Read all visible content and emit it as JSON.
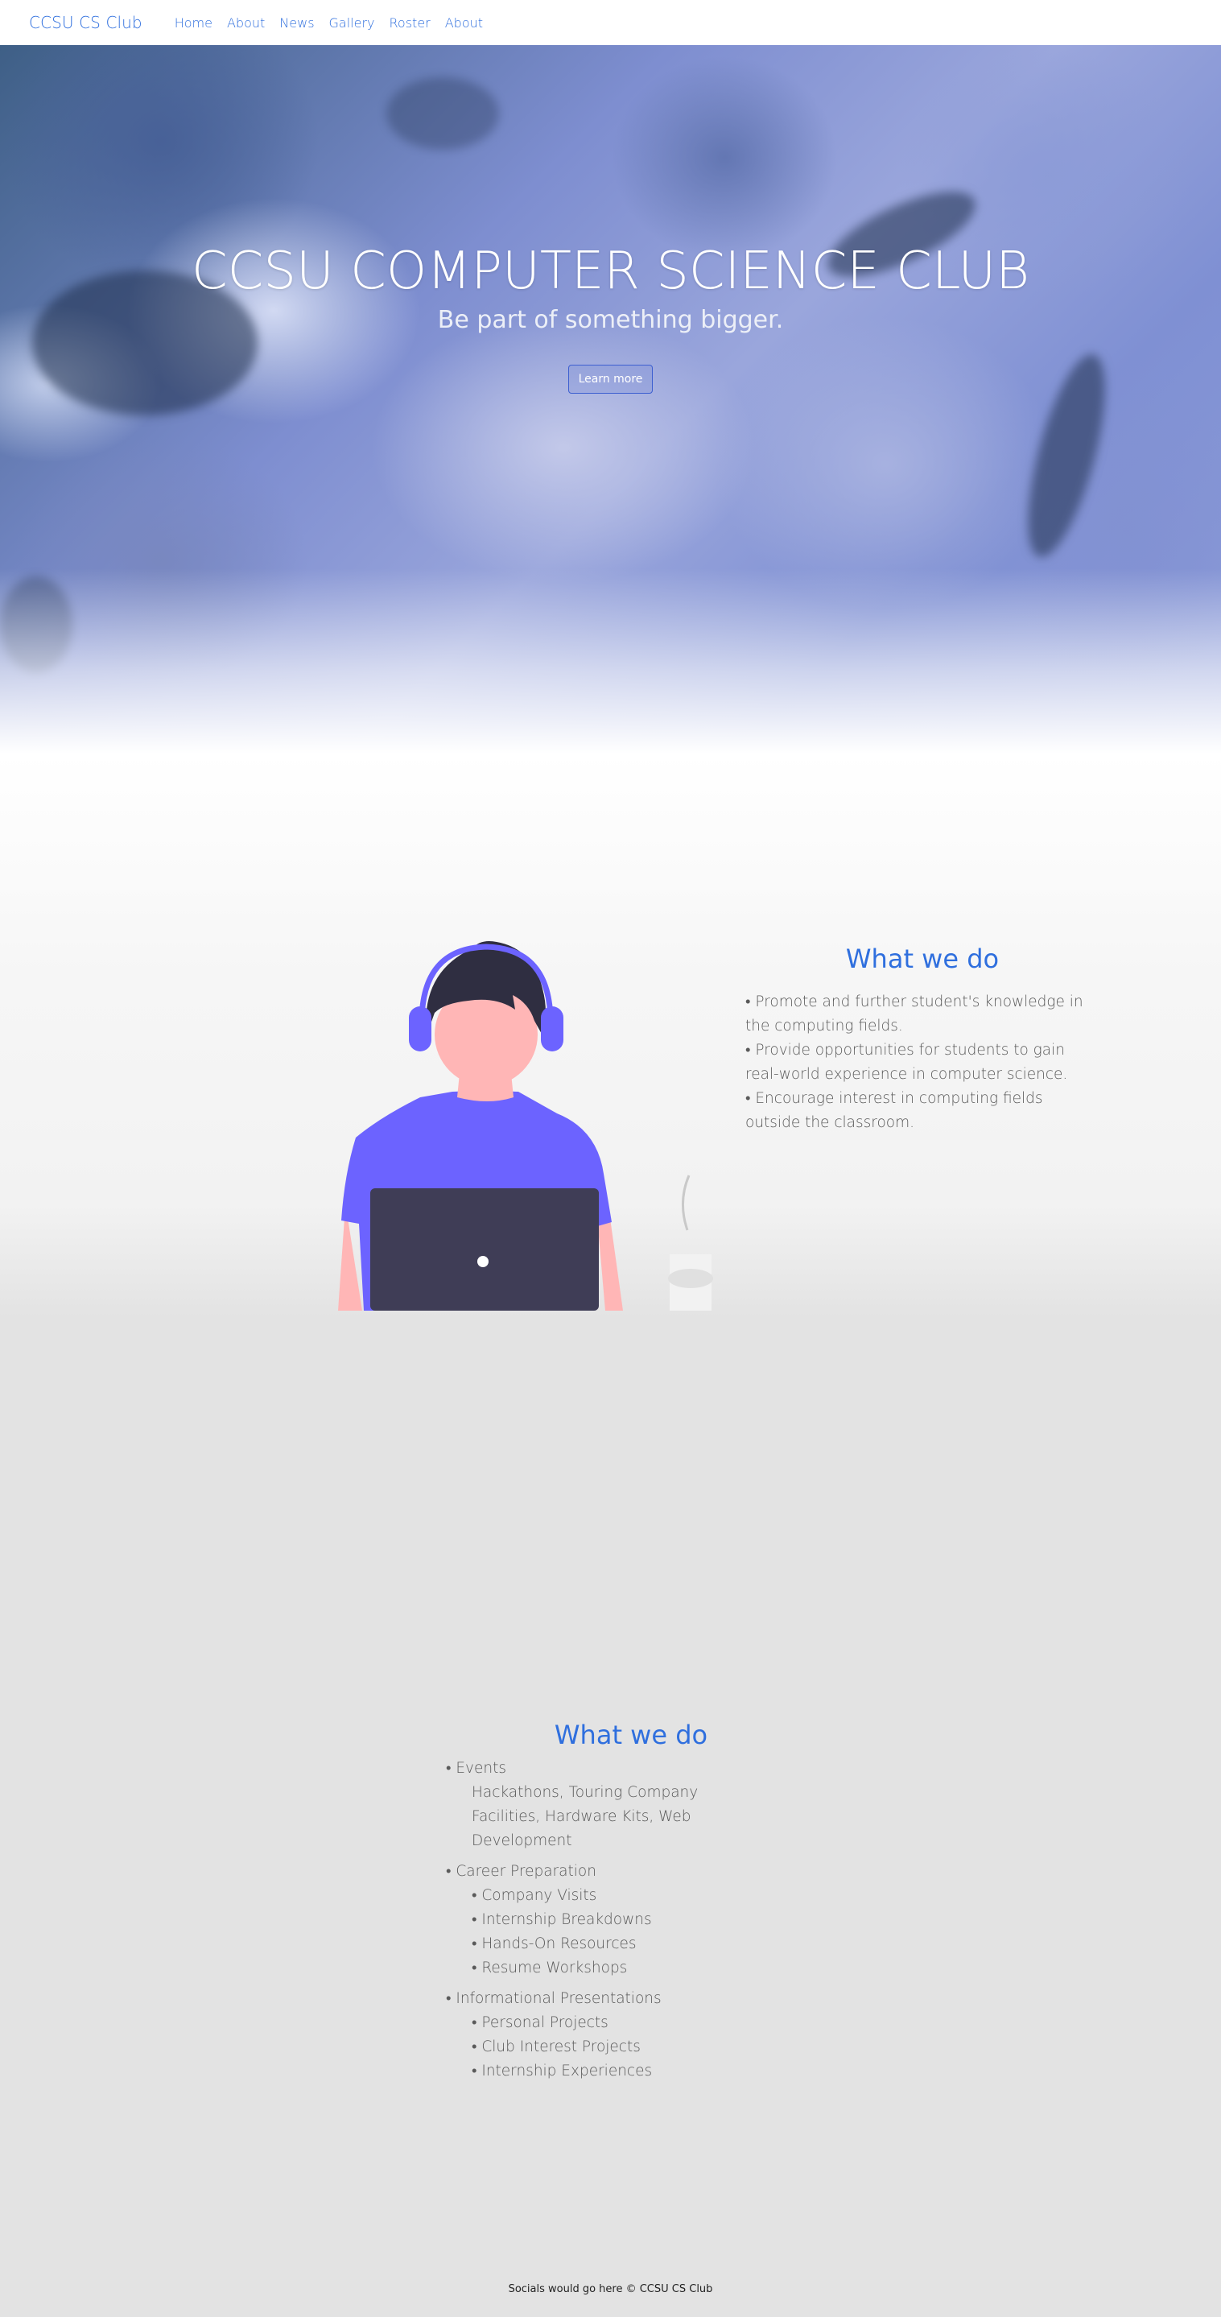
{
  "navbar": {
    "brand": "CCSU CS Club",
    "links": [
      "Home",
      "About",
      "News",
      "Gallery",
      "Roster",
      "About"
    ]
  },
  "hero": {
    "title": "CCSU COMPUTER SCIENCE CLUB",
    "subtitle": "Be part of something bigger.",
    "button_label": "Learn more"
  },
  "what_we_do": {
    "heading": "What we do",
    "items": [
      "• Promote and further student's knowledge in the computing fields.",
      "• Provide opportunities for students to gain real-world experience in computer science.",
      "• Encourage interest in computing fields outside the classroom."
    ]
  },
  "offerings": {
    "heading": "What we do",
    "events": {
      "title": "• Events",
      "description": "Hackathons, Touring Company Facilities, Hardware Kits, Web Development"
    },
    "career": {
      "title": "• Career Preparation",
      "items": [
        "• Company Visits",
        "• Internship Breakdowns",
        "• Hands-On Resources",
        "• Resume Workshops"
      ]
    },
    "presentations": {
      "title": "• Informational Presentations",
      "items": [
        "• Personal Projects",
        "• Club Interest Projects",
        "• Internship Experiences"
      ]
    }
  },
  "footer": {
    "text": "Socials would go here © CCSU CS Club"
  },
  "colors": {
    "accent": "#2f6fde",
    "illustration_shirt": "#6c63ff",
    "illustration_laptop": "#3f3d56",
    "illustration_skin": "#ffb6b6",
    "illustration_hair": "#2f2e41"
  }
}
